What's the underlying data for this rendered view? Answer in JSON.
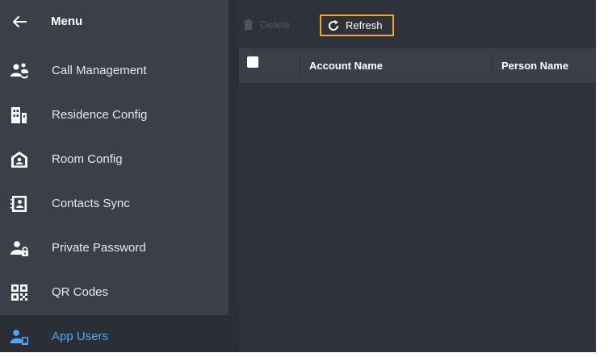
{
  "menu": {
    "title": "Menu",
    "back_icon": "arrow-left-icon"
  },
  "sidebar": {
    "items": [
      {
        "label": "Call Management",
        "icon": "call-management-icon",
        "active": false
      },
      {
        "label": "Residence Config",
        "icon": "building-icon",
        "active": false
      },
      {
        "label": "Room Config",
        "icon": "home-icon",
        "active": false
      },
      {
        "label": "Contacts Sync",
        "icon": "contacts-sync-icon",
        "active": false
      },
      {
        "label": "Private Password",
        "icon": "user-lock-icon",
        "active": false
      },
      {
        "label": "QR Codes",
        "icon": "qr-code-icon",
        "active": false
      },
      {
        "label": "App Users",
        "icon": "app-user-icon",
        "active": true
      }
    ]
  },
  "toolbar": {
    "delete_label": "Delete",
    "refresh_label": "Refresh"
  },
  "table": {
    "columns": [
      "Account Name",
      "Person Name"
    ],
    "rows": []
  },
  "colors": {
    "sidebar_bg": "#3b4048",
    "active_item_bg": "#2a2e35",
    "main_bg": "#2e3239",
    "accent_blue": "#4aa8ff",
    "highlight_orange": "#f5a623"
  }
}
